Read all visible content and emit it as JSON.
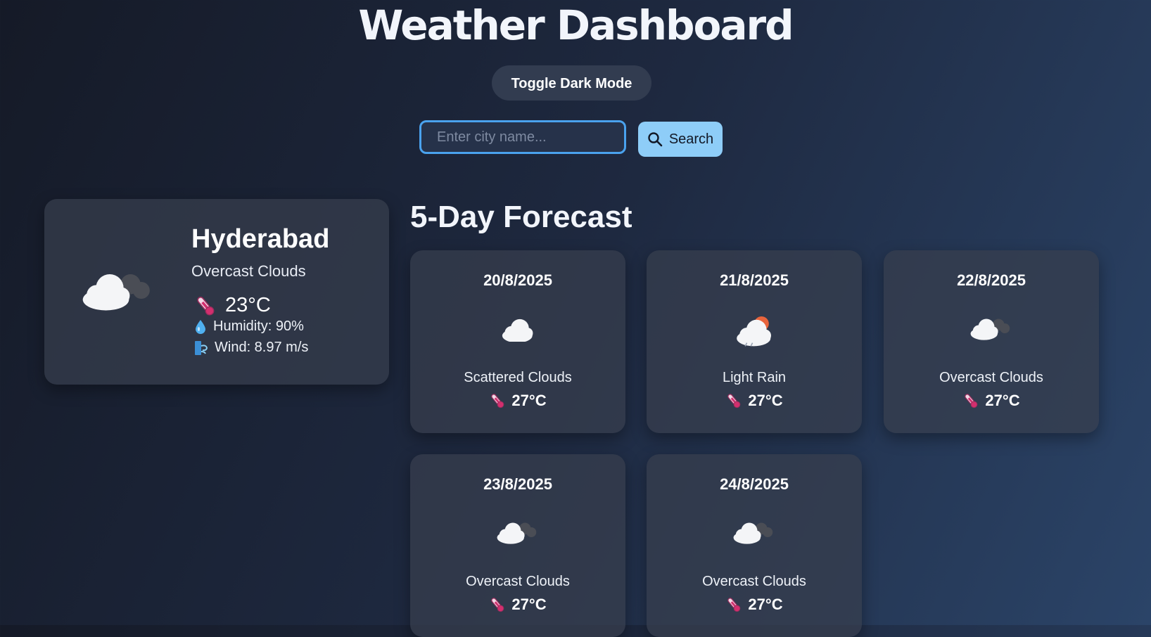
{
  "header": {
    "title": "Weather Dashboard",
    "toggle_label": "Toggle Dark Mode"
  },
  "search": {
    "placeholder": "Enter city name...",
    "button_label": "Search"
  },
  "current": {
    "city": "Hyderabad",
    "description": "Overcast Clouds",
    "temperature": "23°C",
    "humidity": "Humidity: 90%",
    "wind": "Wind: 8.97 m/s",
    "icon": "overcast-clouds-icon"
  },
  "forecast": {
    "title": "5-Day Forecast",
    "days": [
      {
        "date": "20/8/2025",
        "description": "Scattered Clouds",
        "temp": "27°C",
        "icon": "scattered-clouds-icon"
      },
      {
        "date": "21/8/2025",
        "description": "Light Rain",
        "temp": "27°C",
        "icon": "light-rain-icon"
      },
      {
        "date": "22/8/2025",
        "description": "Overcast Clouds",
        "temp": "27°C",
        "icon": "overcast-clouds-icon"
      },
      {
        "date": "23/8/2025",
        "description": "Overcast Clouds",
        "temp": "27°C",
        "icon": "overcast-clouds-icon"
      },
      {
        "date": "24/8/2025",
        "description": "Overcast Clouds",
        "temp": "27°C",
        "icon": "overcast-clouds-icon"
      }
    ]
  },
  "colors": {
    "accent": "#8ecdf8",
    "input_border": "#4aa2ee",
    "card_bg": "#383e4e"
  }
}
